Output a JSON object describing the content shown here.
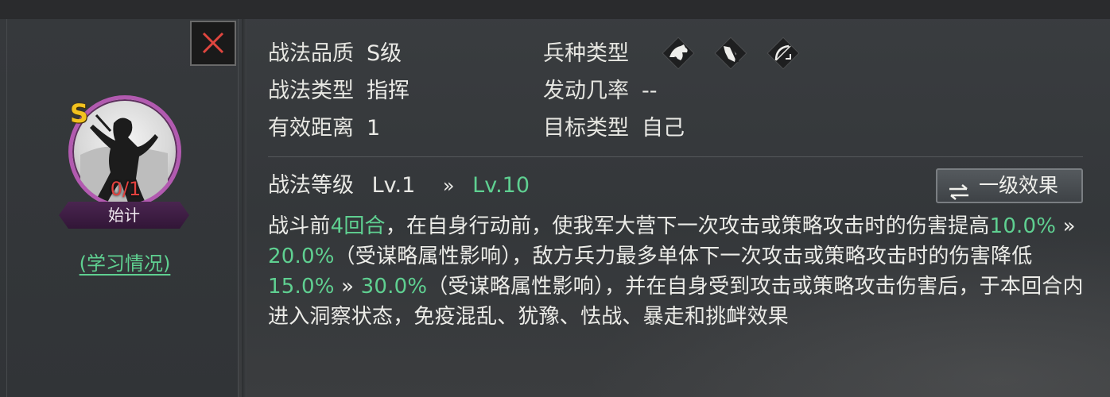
{
  "skill": {
    "grade_badge": "S",
    "learn_count": "0/1",
    "name": "始计",
    "study_link": "(学习情况)"
  },
  "info": {
    "quality_label": "战法品质",
    "quality_value": "S级",
    "type_label": "战法类型",
    "type_value": "指挥",
    "range_label": "有效距离",
    "range_value": "1",
    "troop_label": "兵种类型",
    "troop_icons": [
      "cavalry-icon",
      "shield-icon",
      "bow-icon"
    ],
    "trigger_label": "发动几率",
    "trigger_value": "--",
    "target_label": "目标类型",
    "target_value": "自己"
  },
  "level": {
    "label": "战法等级",
    "from": "Lv.1",
    "arrow": "»",
    "to": "Lv.10",
    "effect_button": "一级效果"
  },
  "description": {
    "p1": "战斗前",
    "rounds": "4回合",
    "p2": "，在自身行动前，使我军大营下一次攻击或策略攻击时的伤害提高",
    "v1_from": "10.0%",
    "arrow": " » ",
    "v1_to": "20.0%",
    "p3": "（受谋略属性影响），敌方兵力最多单体下一次攻击或策略攻击时的伤害降低",
    "v2_from": "15.0%",
    "v2_to": "30.0%",
    "p4": "（受谋略属性影响），并在自身受到攻击或策略攻击伤害后，于本回合内进入洞察状态，免疫混乱、犹豫、怯战、暴走和挑衅效果"
  },
  "colors": {
    "highlight": "#5fd091",
    "count": "#e2413e",
    "grade": "#f2c21f",
    "portrait_ring": "#b25ab0"
  }
}
